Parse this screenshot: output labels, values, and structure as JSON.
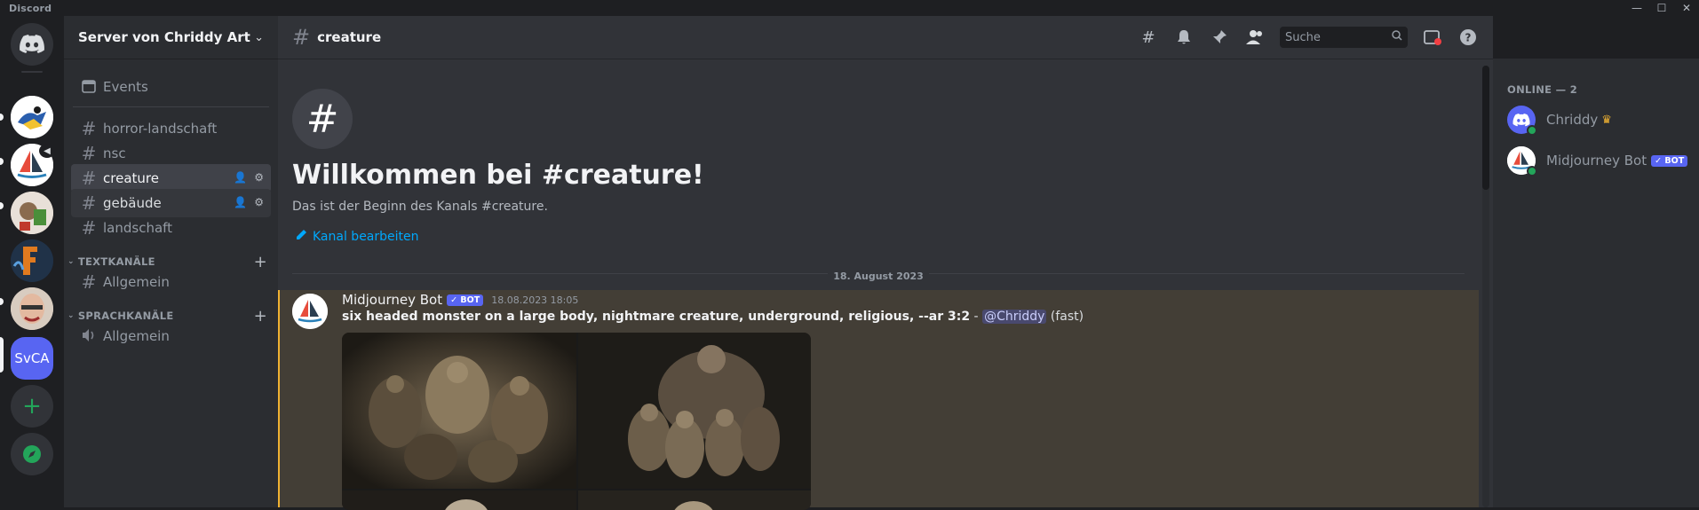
{
  "window": {
    "app_title": "Discord",
    "controls": [
      "—",
      "☐",
      "✕"
    ]
  },
  "server_rail": {
    "home_icon": "discord-logo-icon",
    "add_icon": "+",
    "explore_icon": "compass-icon",
    "active_server_abbr": "SvCA",
    "accent": "#5865f2"
  },
  "sidebar": {
    "server_name": "Server von Chriddy Art",
    "events_label": "Events",
    "channels": [
      {
        "name": "horror-landschaft"
      },
      {
        "name": "nsc"
      },
      {
        "name": "creature"
      },
      {
        "name": "gebäude"
      },
      {
        "name": "landschaft"
      }
    ],
    "categories": [
      {
        "label": "TEXTKANÄLE",
        "channels": [
          {
            "name": "Allgemein"
          }
        ]
      },
      {
        "label": "SPRACHKANÄLE",
        "channels": [
          {
            "name": "Allgemein"
          }
        ]
      }
    ]
  },
  "header": {
    "channel_name": "creature",
    "search_placeholder": "Suche"
  },
  "welcome": {
    "title": "Willkommen bei #creature!",
    "subtitle": "Das ist der Beginn des Kanals #creature.",
    "edit_link": "Kanal bearbeiten"
  },
  "date_divider": "18. August 2023",
  "message": {
    "author": "Midjourney Bot",
    "bot_tag": "✓ BOT",
    "timestamp": "18.08.2023 18:05",
    "prompt": "six headed monster on a large body, nightmare creature, underground, religious, --ar 3:2",
    "separator": " - ",
    "mention": "@Chriddy",
    "mode": "(fast)"
  },
  "members": {
    "header": "ONLINE — 2",
    "list": [
      {
        "name": "Chriddy",
        "badge": "crown"
      },
      {
        "name": "Midjourney Bot",
        "badge": "✓ BOT"
      }
    ]
  }
}
